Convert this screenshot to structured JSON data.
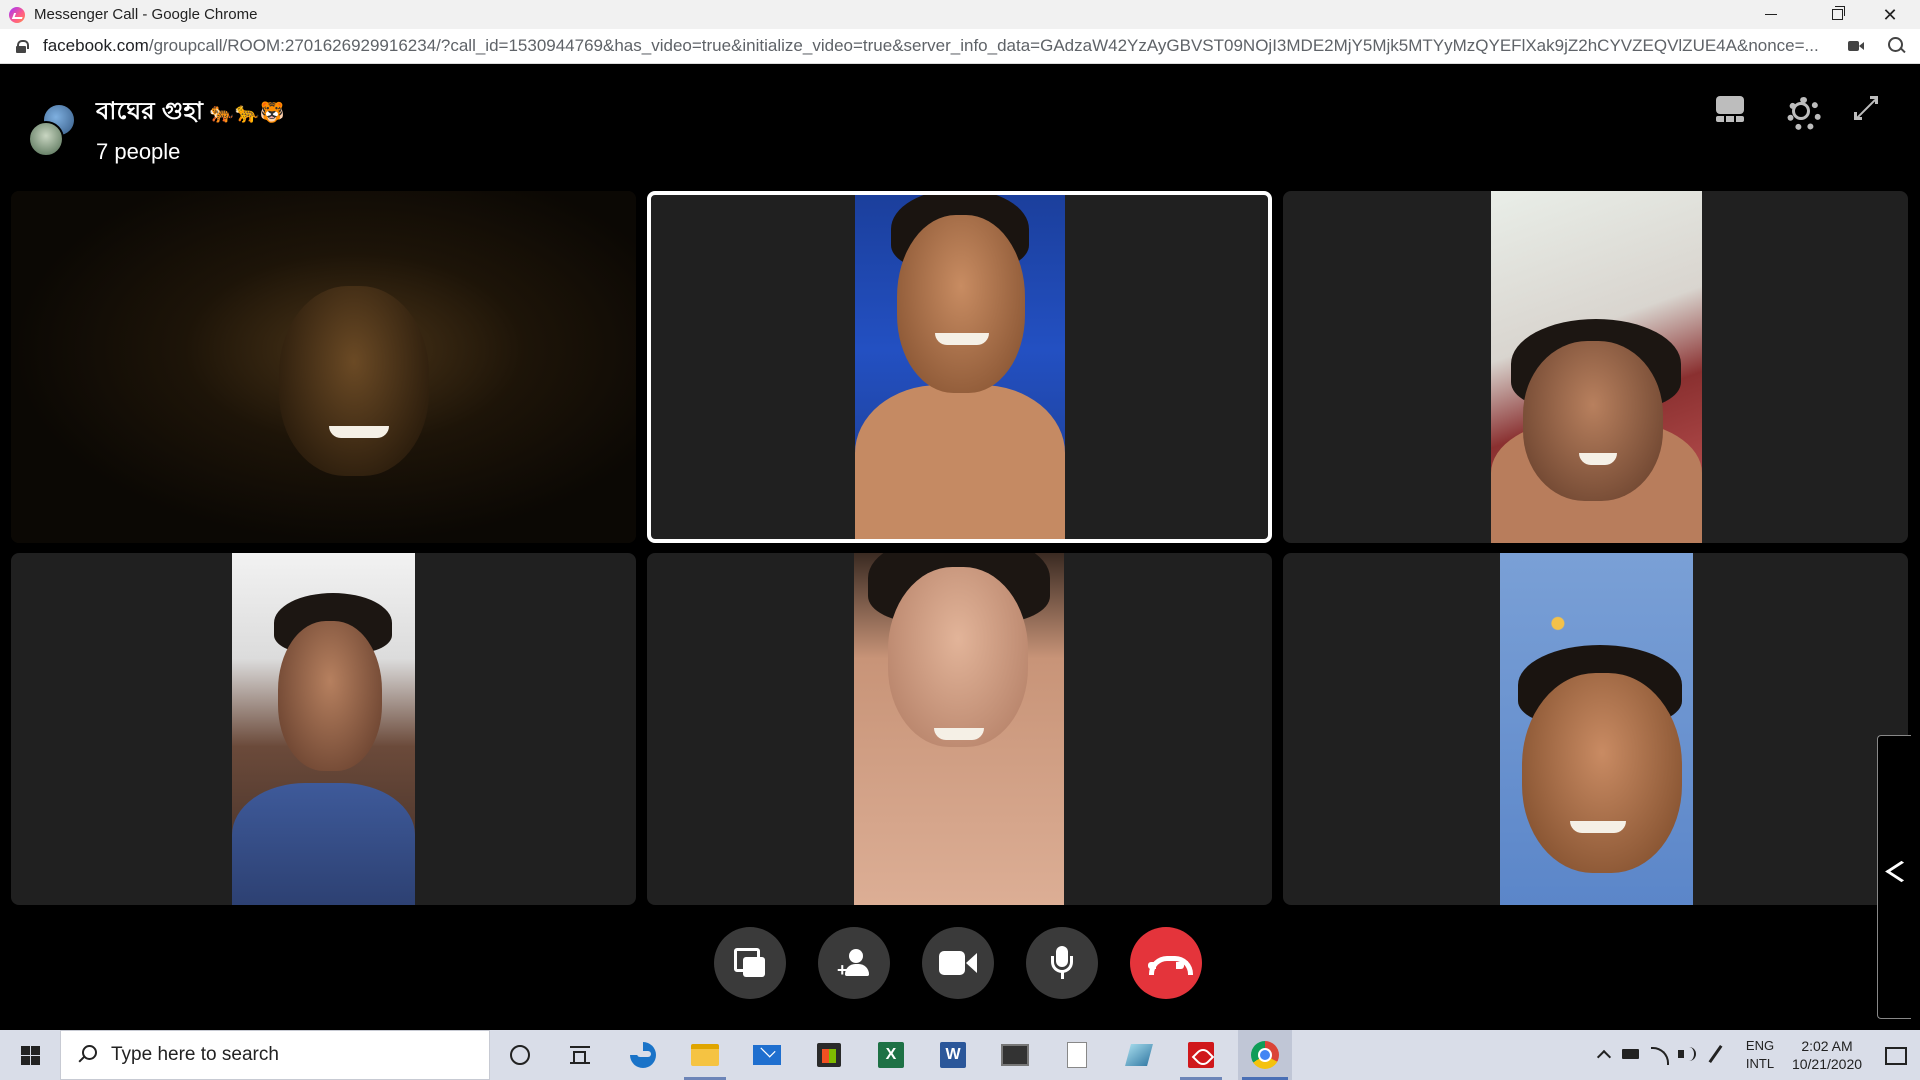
{
  "window": {
    "title": "Messenger Call - Google Chrome",
    "minimize_glyph": "",
    "close_glyph": "✕"
  },
  "addressbar": {
    "host": "facebook.com",
    "path": "/groupcall/ROOM:2701626929916234/?call_id=1530944769&has_video=true&initialize_video=true&server_info_data=GAdzaW42YzAyGBVST09NOjI3MDE2MjY5Mjk5MTYyMzQYEFlXak9jZ2hCYVZEQVlZUE4A&nonce=..."
  },
  "call": {
    "group_name": "বাঘের গুহা",
    "group_emoji": "🐅🐆🐯",
    "people_count": "7 people",
    "tiles": [
      {
        "id": "participant-1",
        "active": false
      },
      {
        "id": "participant-2",
        "active": true
      },
      {
        "id": "participant-3",
        "active": false
      },
      {
        "id": "participant-4",
        "active": false
      },
      {
        "id": "participant-5",
        "active": false
      },
      {
        "id": "participant-6",
        "active": false
      }
    ],
    "controls": [
      "share-screen-button",
      "add-person-button",
      "camera-button",
      "microphone-button",
      "end-call-button"
    ],
    "colors": {
      "end_call": "#e4343b",
      "control_bg": "#3a3a3a",
      "tile_bg": "#202020"
    }
  },
  "taskbar": {
    "search_placeholder": "Type here to search",
    "apps": [
      "cortana",
      "task-view",
      "edge",
      "file-explorer",
      "mail",
      "store",
      "excel",
      "word",
      "terminal",
      "notepad",
      "gem-app",
      "acrobat",
      "chrome"
    ],
    "excel_letter": "X",
    "word_letter": "W",
    "lang_top": "ENG",
    "lang_bottom": "INTL",
    "time": "2:02 AM",
    "date": "10/21/2020"
  }
}
